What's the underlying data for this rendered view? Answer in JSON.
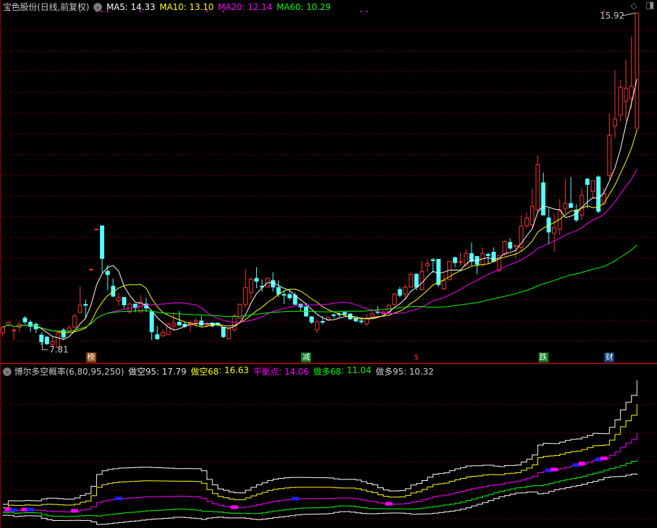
{
  "header": {
    "stock_name": "宝色股份(日线,前复权)",
    "ma5": "MA5: 14.33",
    "ma10": "MA10: 13.10",
    "ma20": "MA20: 12.14",
    "ma60": "MA60: 10.29"
  },
  "indicator_header": {
    "name": "博尔多空概率(6,80,95,250)",
    "short95": "做空95: 17.79",
    "short68_label": "做空",
    "short68_value": "68: 16.63",
    "balance_label": "平衡点",
    "balance_value": ": 14.06",
    "long68_label": "做多",
    "long68_value": "68: 11.04",
    "long95": "做多95: 10.32"
  },
  "annotations": {
    "high_label": "15.92",
    "low_label": "7.81"
  },
  "signals": [
    {
      "text": "榜",
      "candle": 16,
      "bg": "#8b4a14",
      "fg": "#ffffff"
    },
    {
      "text": "减",
      "candle": 55,
      "bg": "#0a7a1a",
      "fg": "#ffffff"
    },
    {
      "text": "$",
      "candle": 75,
      "bg": "transparent",
      "fg": "#ff2020"
    },
    {
      "text": "跌",
      "candle": 98,
      "bg": "#0a7a1a",
      "fg": "#ffffff"
    },
    {
      "text": "财",
      "candle": 110,
      "bg": "#0c3f7a",
      "fg": "#ffffff"
    }
  ],
  "colors": {
    "up": "#ff3232",
    "down": "#54ffff",
    "ma5": "#ffffff",
    "ma10": "#ffff00",
    "ma20": "#ff00ff",
    "ma60": "#00ff00",
    "grid": "#a00000"
  },
  "chart_data": {
    "type": "candlestick",
    "title": "宝色股份 日线 前复权",
    "price_range": [
      7.5,
      16.0
    ],
    "grid_step": 0.5,
    "ma_periods": [
      5,
      10,
      20,
      60
    ],
    "top_marker_candles": [
      14,
      17,
      18,
      19,
      25,
      37,
      40,
      65,
      66,
      109
    ],
    "candles_ochl_note": "each candle is [open, close, high, low]",
    "candles": [
      [
        8.19,
        8.33,
        8.36,
        8.1
      ],
      [
        8.38,
        8.45,
        8.47,
        8.33
      ],
      [
        8.24,
        8.26,
        8.31,
        8.03
      ],
      [
        8.33,
        8.4,
        8.47,
        8.22
      ],
      [
        8.55,
        8.46,
        8.6,
        8.41
      ],
      [
        8.45,
        8.35,
        8.5,
        8.22
      ],
      [
        8.4,
        8.29,
        8.45,
        8.19
      ],
      [
        8.14,
        7.98,
        8.21,
        7.9
      ],
      [
        8.09,
        7.93,
        8.12,
        7.9
      ],
      [
        7.91,
        7.98,
        8.12,
        7.86
      ],
      [
        7.84,
        8.19,
        8.22,
        7.81
      ],
      [
        8.26,
        8.09,
        8.31,
        8.02
      ],
      [
        8.24,
        8.31,
        8.38,
        8.21
      ],
      [
        8.33,
        8.6,
        8.65,
        8.29
      ],
      [
        8.69,
        8.86,
        9.32,
        8.67
      ],
      [
        8.88,
        8.86,
        9.0,
        8.55
      ],
      [
        9.73,
        9.73,
        9.73,
        9.73
      ],
      [
        10.7,
        10.7,
        10.7,
        10.7
      ],
      [
        10.78,
        9.99,
        10.78,
        9.65
      ],
      [
        9.68,
        9.6,
        9.82,
        9.22
      ],
      [
        9.32,
        9.08,
        9.5,
        9.05
      ],
      [
        8.97,
        9.04,
        9.15,
        8.86
      ],
      [
        9.05,
        8.87,
        9.05,
        8.8
      ],
      [
        8.7,
        8.89,
        8.94,
        8.66
      ],
      [
        8.89,
        8.8,
        8.89,
        8.69
      ],
      [
        8.7,
        8.94,
        9.11,
        8.69
      ],
      [
        8.89,
        8.79,
        9.04,
        8.7
      ],
      [
        8.7,
        8.22,
        8.7,
        8.02
      ],
      [
        8.15,
        8.05,
        8.36,
        8.02
      ],
      [
        8.12,
        8.2,
        8.29,
        8.1
      ],
      [
        8.15,
        8.4,
        8.45,
        8.14
      ],
      [
        8.36,
        8.43,
        8.69,
        8.26
      ],
      [
        8.45,
        8.38,
        8.72,
        8.38
      ],
      [
        8.4,
        8.35,
        8.45,
        8.31
      ],
      [
        8.36,
        8.45,
        8.48,
        8.22
      ],
      [
        8.45,
        8.48,
        8.55,
        8.33
      ],
      [
        8.48,
        8.38,
        8.6,
        8.35
      ],
      [
        8.38,
        8.41,
        8.46,
        8.33
      ],
      [
        8.43,
        8.36,
        8.45,
        8.33
      ],
      [
        8.43,
        8.38,
        8.45,
        8.35
      ],
      [
        8.33,
        8.1,
        8.33,
        8.07
      ],
      [
        8.05,
        8.29,
        8.29,
        8.05
      ],
      [
        8.27,
        8.6,
        8.65,
        8.22
      ],
      [
        8.55,
        8.88,
        8.9,
        8.53
      ],
      [
        8.88,
        9.29,
        9.73,
        8.79
      ],
      [
        9.17,
        9.49,
        9.53,
        9.01
      ],
      [
        9.51,
        9.44,
        9.78,
        9.27
      ],
      [
        9.32,
        9.3,
        9.48,
        9.19
      ],
      [
        9.3,
        9.51,
        9.53,
        9.29
      ],
      [
        9.46,
        9.3,
        9.66,
        9.19
      ],
      [
        9.29,
        9.13,
        9.46,
        9.06
      ],
      [
        9.12,
        9.11,
        9.22,
        8.89
      ],
      [
        9.12,
        9.04,
        9.22,
        8.98
      ],
      [
        9.1,
        8.88,
        9.17,
        8.87
      ],
      [
        8.89,
        8.82,
        8.89,
        8.72
      ],
      [
        8.82,
        8.6,
        8.92,
        8.58
      ],
      [
        8.58,
        8.45,
        8.6,
        8.41
      ],
      [
        8.27,
        8.46,
        8.5,
        8.19
      ],
      [
        8.47,
        8.45,
        8.6,
        8.4
      ],
      [
        8.5,
        8.57,
        8.57,
        8.48
      ],
      [
        8.63,
        8.62,
        8.66,
        8.55
      ],
      [
        8.65,
        8.64,
        8.69,
        8.57
      ],
      [
        8.69,
        8.64,
        8.7,
        8.62
      ],
      [
        8.65,
        8.53,
        8.67,
        8.5
      ],
      [
        8.55,
        8.48,
        8.55,
        8.46
      ],
      [
        8.48,
        8.46,
        8.53,
        8.41
      ],
      [
        8.41,
        8.55,
        8.65,
        8.36
      ],
      [
        8.58,
        8.65,
        8.77,
        8.56
      ],
      [
        8.7,
        8.69,
        8.84,
        8.64
      ],
      [
        8.65,
        8.7,
        8.72,
        8.63
      ],
      [
        8.7,
        8.86,
        8.9,
        8.67
      ],
      [
        8.88,
        9.13,
        9.17,
        8.86
      ],
      [
        9.24,
        9.1,
        9.3,
        9.05
      ],
      [
        9.13,
        9.3,
        9.36,
        9.03
      ],
      [
        9.3,
        9.61,
        9.65,
        9.29
      ],
      [
        9.61,
        9.3,
        9.63,
        9.22
      ],
      [
        9.24,
        9.68,
        9.93,
        9.22
      ],
      [
        9.82,
        9.87,
        9.97,
        9.65
      ],
      [
        9.96,
        9.94,
        10.0,
        9.65
      ],
      [
        9.97,
        9.36,
        9.97,
        9.3
      ],
      [
        9.26,
        9.45,
        9.6,
        9.22
      ],
      [
        9.48,
        9.92,
        9.92,
        9.46
      ],
      [
        10.01,
        9.89,
        10.04,
        9.78
      ],
      [
        9.9,
        9.92,
        10.14,
        9.82
      ],
      [
        9.82,
        10.11,
        10.21,
        9.82
      ],
      [
        10.11,
        9.92,
        10.38,
        9.82
      ],
      [
        10.04,
        9.85,
        10.04,
        9.61
      ],
      [
        9.84,
        10.11,
        10.26,
        9.78
      ],
      [
        10.09,
        10.06,
        10.13,
        9.85
      ],
      [
        10.14,
        9.92,
        10.26,
        9.9
      ],
      [
        9.7,
        10.06,
        10.06,
        9.66
      ],
      [
        10.09,
        10.4,
        10.43,
        10.06
      ],
      [
        10.38,
        10.24,
        10.48,
        10.18
      ],
      [
        10.28,
        10.31,
        10.33,
        10.0
      ],
      [
        10.26,
        10.77,
        11.03,
        10.16
      ],
      [
        10.78,
        10.97,
        11.1,
        10.72
      ],
      [
        10.81,
        11.25,
        11.68,
        10.72
      ],
      [
        11.16,
        12.26,
        12.48,
        11.1
      ],
      [
        11.82,
        11.04,
        12.06,
        11.04
      ],
      [
        10.97,
        10.63,
        11.2,
        10.33
      ],
      [
        10.6,
        10.74,
        11.08,
        10.14
      ],
      [
        10.7,
        11.16,
        11.43,
        10.55
      ],
      [
        11.2,
        11.32,
        11.91,
        11.08
      ],
      [
        11.32,
        11.22,
        11.96,
        11.22
      ],
      [
        11.16,
        10.92,
        11.3,
        10.87
      ],
      [
        11.04,
        11.52,
        11.68,
        10.92
      ],
      [
        11.91,
        11.78,
        11.93,
        11.2
      ],
      [
        11.61,
        11.87,
        11.87,
        11.43
      ],
      [
        11.96,
        11.13,
        12.0,
        11.08
      ],
      [
        11.3,
        11.56,
        11.7,
        11.3
      ],
      [
        12.0,
        12.97,
        13.5,
        11.9
      ],
      [
        13.19,
        13.36,
        14.55,
        12.9
      ],
      [
        13.46,
        14.13,
        14.3,
        13.3
      ],
      [
        13.79,
        14.1,
        14.8,
        13.3
      ],
      [
        13.86,
        14.15,
        15.35,
        13.6
      ],
      [
        13.14,
        15.92,
        15.92,
        13.07
      ]
    ],
    "indicator": {
      "name": "博尔多空概率",
      "params": [
        6,
        80,
        95,
        250
      ],
      "lines": [
        "做空95",
        "做空68",
        "平衡点",
        "做多68",
        "做多95"
      ],
      "last_values": [
        17.79,
        16.63,
        14.06,
        11.04,
        10.32
      ],
      "line_colors": [
        "#ffffff",
        "#ffff00",
        "#ff00ff",
        "#00ff00",
        "#ffffff"
      ]
    }
  }
}
